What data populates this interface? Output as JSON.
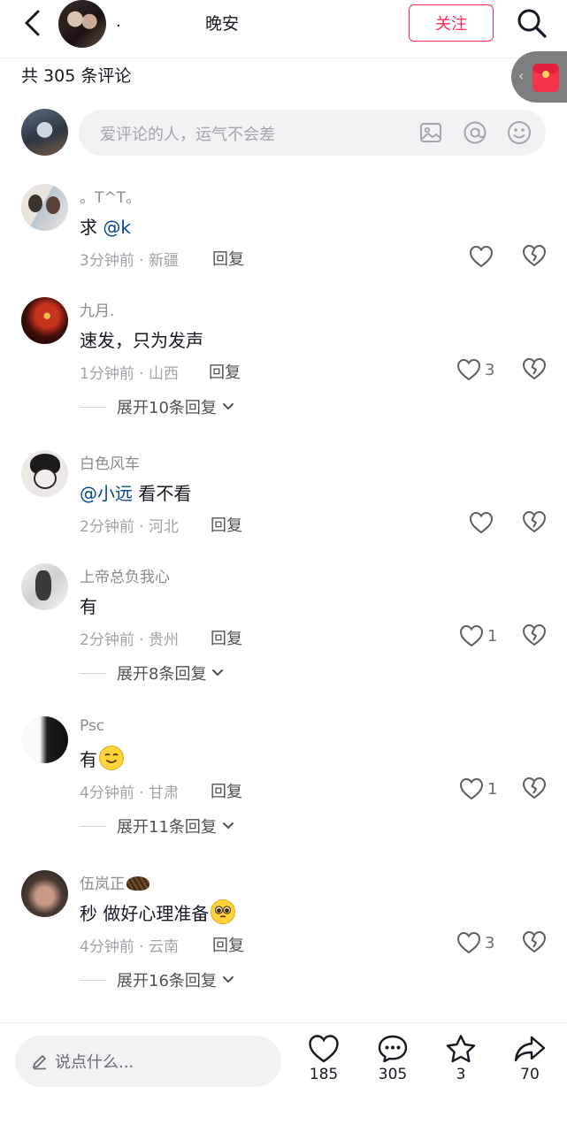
{
  "header": {
    "author_name": ".",
    "title": "晚安",
    "follow_label": "关注"
  },
  "comment_count_text": "共 305 条评论",
  "composer": {
    "placeholder": "爱评论的人，运气不会差"
  },
  "comments": [
    {
      "user": "。T^T。",
      "text_mention": "@k",
      "time_location": "3分钟前 · 新疆",
      "reply_label": "回复",
      "likes": ""
    },
    {
      "user": "九月.",
      "text": "速发，只为发声",
      "time_location": "1分钟前 · 山西",
      "reply_label": "回复",
      "likes": "3",
      "expand": "展开10条回复"
    },
    {
      "user": "白色风车",
      "text_mention": "@小远",
      "text": " 看不看",
      "time_location": "2分钟前 · 河北",
      "reply_label": "回复",
      "likes": ""
    },
    {
      "user": "上帝总负我心",
      "text": "有",
      "time_location": "2分钟前 · 贵州",
      "reply_label": "回复",
      "likes": "1",
      "expand": "展开8条回复"
    },
    {
      "user": "Psc",
      "text": "有",
      "time_location": "4分钟前 · 甘肃",
      "reply_label": "回复",
      "likes": "1",
      "expand": "展开11条回复"
    },
    {
      "user": "伍岚正",
      "text": "秒 做好心理准备",
      "time_location": "4分钟前 · 云南",
      "reply_label": "回复",
      "likes": "3",
      "expand": "展开16条回复"
    }
  ],
  "bottom": {
    "placeholder": "说点什么...",
    "like_count": "185",
    "comment_count": "305",
    "favorite_count": "3",
    "share_count": "70"
  },
  "colors": {
    "accent": "#fe2c55",
    "mention": "#04498d",
    "muted": "#8a8b91"
  }
}
